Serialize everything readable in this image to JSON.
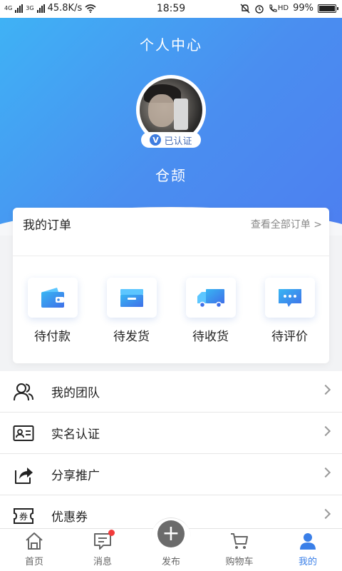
{
  "status_bar": {
    "net_1": "4G",
    "net_2": "3G",
    "speed": "45.8K/s",
    "time": "18:59",
    "volte": "HD",
    "battery": "99%",
    "battery_level": 0.99
  },
  "header": {
    "title": "个人中心",
    "verified_mark": "V",
    "verified_label": "已认证",
    "username": "仓颉"
  },
  "orders": {
    "title": "我的订单",
    "view_all": "查看全部订单 >",
    "items": [
      {
        "label": "待付款",
        "icon": "wallet-icon"
      },
      {
        "label": "待发货",
        "icon": "box-icon"
      },
      {
        "label": "待收货",
        "icon": "truck-icon"
      },
      {
        "label": "待评价",
        "icon": "comment-icon"
      }
    ]
  },
  "menu": [
    {
      "label": "我的团队",
      "icon": "team-icon"
    },
    {
      "label": "实名认证",
      "icon": "id-card-icon"
    },
    {
      "label": "分享推广",
      "icon": "share-icon"
    },
    {
      "label": "优惠券",
      "icon": "coupon-icon",
      "icon_text": "券"
    }
  ],
  "tabbar": {
    "tabs": [
      {
        "label": "首页",
        "icon": "home-icon"
      },
      {
        "label": "消息",
        "icon": "message-icon"
      },
      {
        "label": "发布",
        "icon": "plus-icon",
        "glyph": "+"
      },
      {
        "label": "购物车",
        "icon": "cart-icon"
      },
      {
        "label": "我的",
        "icon": "user-icon"
      }
    ],
    "active_index": 4
  },
  "colors": {
    "accent": "#3a7fe8",
    "gradient_start": "#3fb2f5",
    "gradient_end": "#4d7ff0",
    "badge_red": "#f23b3b"
  }
}
